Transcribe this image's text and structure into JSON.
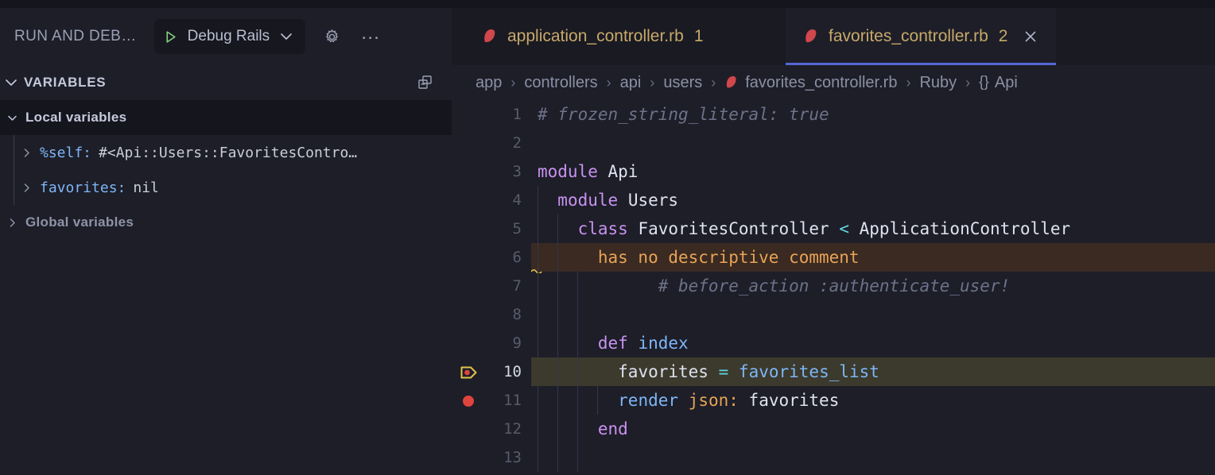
{
  "sidebar": {
    "title": "RUN AND DEB…",
    "debug_config": "Debug Rails",
    "icons": {
      "play": "play-icon",
      "chevron": "chevron-down-icon",
      "gear": "gear-icon",
      "more": "…",
      "collapse": "collapse-all-icon"
    },
    "section": "VARIABLES",
    "groups": [
      {
        "label": "Local variables",
        "expanded": true
      },
      {
        "label": "Global variables",
        "expanded": false
      }
    ],
    "variables": [
      {
        "name": "%self:",
        "value": "#<Api::Users::FavoritesContro…"
      },
      {
        "name": "favorites:",
        "value": "nil"
      }
    ]
  },
  "editor": {
    "tabs": [
      {
        "name": "application_controller.rb",
        "badge": "1",
        "active": false,
        "closable": false
      },
      {
        "name": "favorites_controller.rb",
        "badge": "2",
        "active": true,
        "closable": true
      }
    ],
    "breadcrumb": [
      "app",
      "controllers",
      "api",
      "users",
      "favorites_controller.rb",
      "Ruby",
      "Api"
    ],
    "breadcrumb_brace": "{}",
    "lines": [
      {
        "num": "1",
        "marker": "none",
        "highlight": "none",
        "indents": 0
      },
      {
        "num": "2",
        "marker": "none",
        "highlight": "none",
        "indents": 0
      },
      {
        "num": "3",
        "marker": "none",
        "highlight": "none",
        "indents": 0
      },
      {
        "num": "4",
        "marker": "none",
        "highlight": "none",
        "indents": 1
      },
      {
        "num": "5",
        "marker": "none",
        "highlight": "none",
        "indents": 2
      },
      {
        "num": "6",
        "marker": "none",
        "highlight": "error",
        "indents": 2
      },
      {
        "num": "7",
        "marker": "none",
        "highlight": "none",
        "indents": 3
      },
      {
        "num": "8",
        "marker": "none",
        "highlight": "none",
        "indents": 3
      },
      {
        "num": "9",
        "marker": "none",
        "highlight": "none",
        "indents": 3
      },
      {
        "num": "10",
        "marker": "execution",
        "highlight": "current",
        "indents": 4
      },
      {
        "num": "11",
        "marker": "breakpoint",
        "highlight": "none",
        "indents": 4
      },
      {
        "num": "12",
        "marker": "none",
        "highlight": "none",
        "indents": 3
      },
      {
        "num": "13",
        "marker": "none",
        "highlight": "none",
        "indents": 3
      }
    ],
    "code": [
      "# frozen_string_literal: true",
      "",
      "module Api",
      "  module Users",
      "    class FavoritesController < ApplicationController",
      "      has no descriptive comment",
      "      # before_action :authenticate_user!",
      "",
      "      def index",
      "        favorites = favorites_list",
      "        render json: favorites",
      "      end",
      ""
    ]
  },
  "colors": {
    "bg": "#1d1e28",
    "sidebar_bg": "#1d1e28",
    "tabbar_bg": "#191a22",
    "accent_tab_underline": "#5566d6",
    "tab_text": "#c8a96a",
    "ruby_icon": "#d0474d",
    "breakpoint": "#e0443e",
    "execution_pointer": "#e3c34a",
    "error_text": "#e8a355",
    "error_band": "#3a2a22",
    "current_line_band": "#3b3a2d",
    "play_icon": "#89d185",
    "variable_name": "#7eb6f6",
    "keyword": "#c992f0",
    "operator": "#62d5e0",
    "comment": "#6d7289"
  }
}
